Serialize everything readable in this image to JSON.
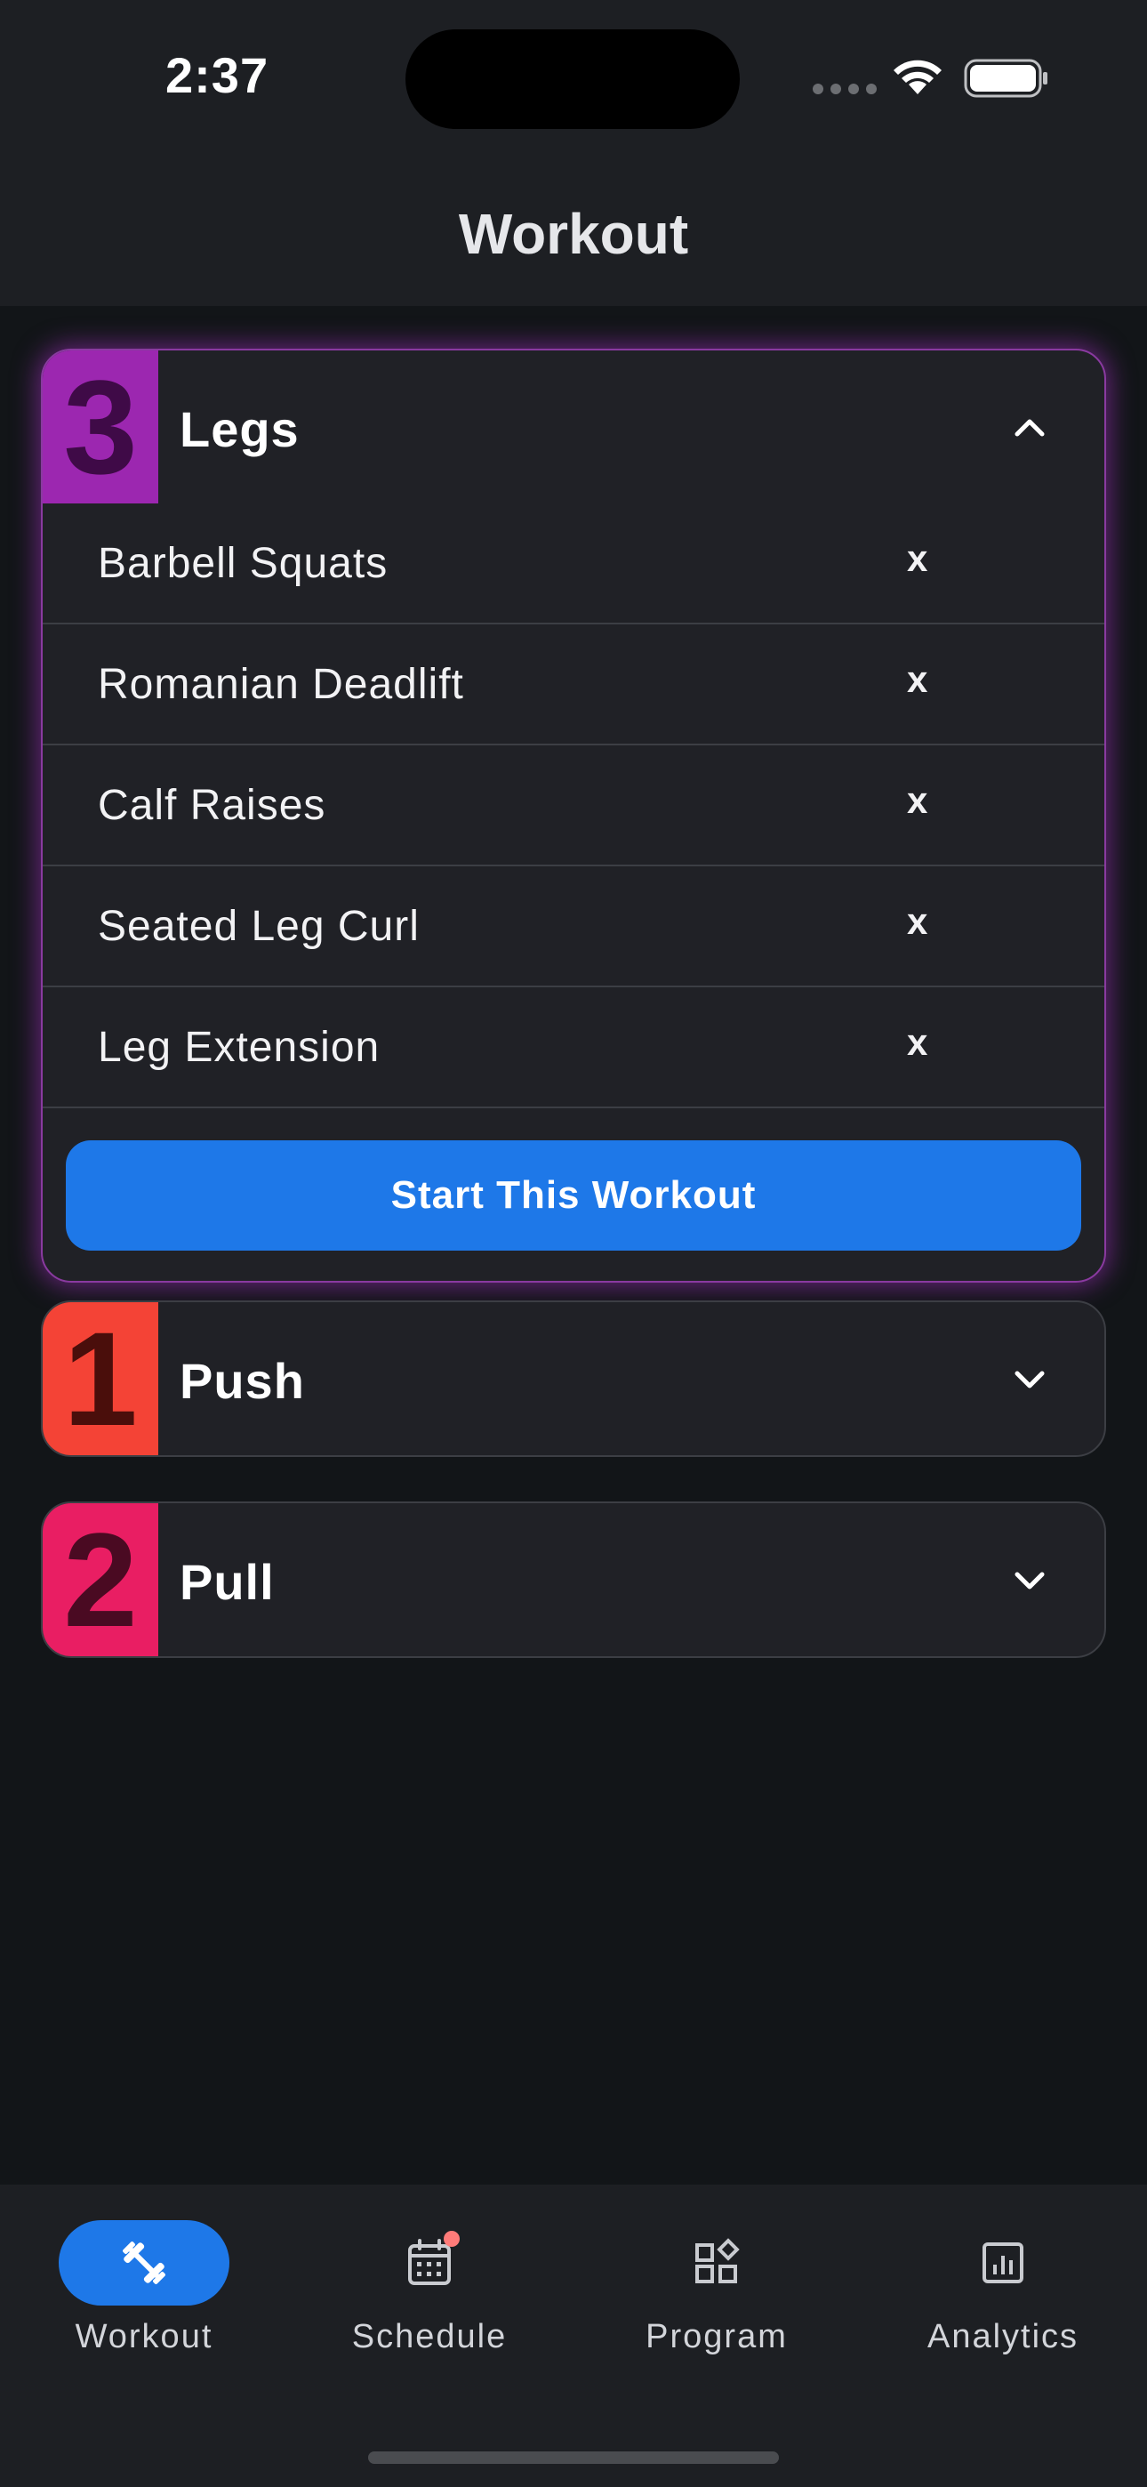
{
  "status_bar": {
    "time": "2:37"
  },
  "header": {
    "title": "Workout"
  },
  "cards": [
    {
      "number": "3",
      "title": "Legs",
      "color": "#9c27b0",
      "digit_color": "#3f0a47",
      "expanded": true,
      "exercises": [
        {
          "name": "Barbell Squats",
          "remove": "x"
        },
        {
          "name": "Romanian Deadlift",
          "remove": "x"
        },
        {
          "name": "Calf Raises",
          "remove": "x"
        },
        {
          "name": "Seated Leg Curl",
          "remove": "x"
        },
        {
          "name": "Leg Extension",
          "remove": "x"
        }
      ],
      "start_label": "Start This Workout"
    },
    {
      "number": "1",
      "title": "Push",
      "color": "#f44336",
      "digit_color": "#4a0e0b",
      "expanded": false
    },
    {
      "number": "2",
      "title": "Pull",
      "color": "#e91e63",
      "digit_color": "#4a0a22",
      "expanded": false
    }
  ],
  "bottom_nav": [
    {
      "label": "Workout",
      "icon": "dumbbell-icon",
      "active": true
    },
    {
      "label": "Schedule",
      "icon": "calendar-icon",
      "active": false,
      "notification": true
    },
    {
      "label": "Program",
      "icon": "widgets-icon",
      "active": false
    },
    {
      "label": "Analytics",
      "icon": "analytics-icon",
      "active": false
    }
  ],
  "colors": {
    "accent": "#1e78e8",
    "background": "#121518",
    "surface": "#202126"
  }
}
